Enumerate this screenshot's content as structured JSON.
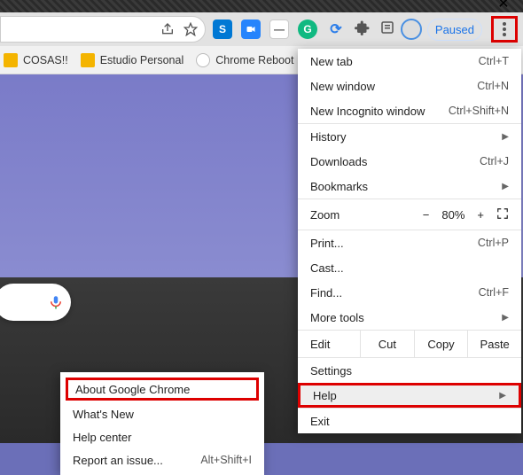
{
  "window": {
    "close": "✕",
    "max": "▢",
    "min": "—"
  },
  "toolbar": {
    "paused_label": "Paused",
    "ext": {
      "s": "S",
      "meet": "▮",
      "g_circle": "G",
      "reload": "⟳"
    }
  },
  "bookmarks": {
    "items": [
      {
        "label": "COSAS!!"
      },
      {
        "label": "Estudio Personal"
      },
      {
        "label": "Chrome Reboot"
      }
    ]
  },
  "menu": {
    "new_tab": {
      "label": "New tab",
      "shortcut": "Ctrl+T"
    },
    "new_window": {
      "label": "New window",
      "shortcut": "Ctrl+N"
    },
    "new_incognito": {
      "label": "New Incognito window",
      "shortcut": "Ctrl+Shift+N"
    },
    "history": {
      "label": "History"
    },
    "downloads": {
      "label": "Downloads",
      "shortcut": "Ctrl+J"
    },
    "bookmarks": {
      "label": "Bookmarks"
    },
    "zoom": {
      "label": "Zoom",
      "minus": "−",
      "value": "80%",
      "plus": "+"
    },
    "print": {
      "label": "Print...",
      "shortcut": "Ctrl+P"
    },
    "cast": {
      "label": "Cast..."
    },
    "find": {
      "label": "Find...",
      "shortcut": "Ctrl+F"
    },
    "more_tools": {
      "label": "More tools"
    },
    "edit": {
      "label": "Edit",
      "cut": "Cut",
      "copy": "Copy",
      "paste": "Paste"
    },
    "settings": {
      "label": "Settings"
    },
    "help": {
      "label": "Help"
    },
    "exit": {
      "label": "Exit"
    }
  },
  "help_menu": {
    "about": {
      "label": "About Google Chrome"
    },
    "whats_new": {
      "label": "What's New"
    },
    "help_center": {
      "label": "Help center"
    },
    "report": {
      "label": "Report an issue...",
      "shortcut": "Alt+Shift+I"
    }
  }
}
